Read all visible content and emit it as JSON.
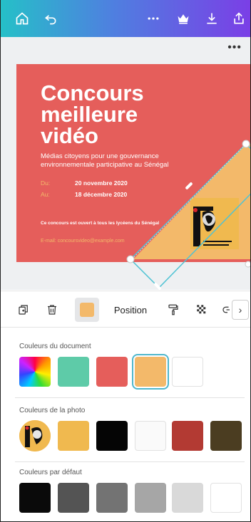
{
  "topbar": {
    "icons": [
      "home-icon",
      "undo-icon",
      "more-icon",
      "crown-icon",
      "download-icon",
      "share-icon"
    ],
    "gradient": [
      "#25c0c8",
      "#7b3ee6"
    ]
  },
  "canvas": {
    "more_label": "•••",
    "design": {
      "title_line1": "Concours",
      "title_line2": "meilleure",
      "title_line3": "vidéo",
      "subtitle": "Médias citoyens pour une gouvernance environnementale participative au Sénégal",
      "from_label": "Du:",
      "from_date": "20 novembre 2020",
      "to_label": "Au:",
      "to_date": "18 décembre 2020",
      "note": "Ce concours est ouvert à tous les lycéens du Sénégal",
      "email": "E-mail: concoursvideo@example.com",
      "background_color": "#e55e5b",
      "shape_color": "#f3b96a"
    }
  },
  "toolbar": {
    "position_label": "Position",
    "next_label": "›",
    "selected_color": "#f3b96a"
  },
  "colors": {
    "document_title": "Couleurs du document",
    "document": [
      "rainbow",
      "#5ecba8",
      "#e55e5b",
      "#f3b96a",
      "#ffffff"
    ],
    "photo_title": "Couleurs de la photo",
    "photo": [
      "#f0b94f",
      "#050505",
      "#fafafa",
      "#b33a33",
      "#4b3d21"
    ],
    "default_title": "Couleurs par défaut",
    "default": [
      "#0a0a0a",
      "#545454",
      "#737373",
      "#a6a6a6",
      "#d9d9d9",
      "#ffffff"
    ]
  }
}
